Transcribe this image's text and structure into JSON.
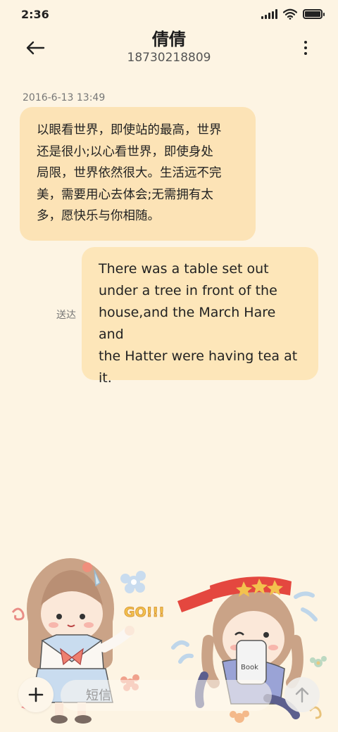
{
  "status_bar": {
    "time": "2:36",
    "battery_level": 1.0
  },
  "header": {
    "contact_name": "倩倩",
    "contact_number": "18730218809"
  },
  "conversation": {
    "timestamp": "2016-6-13 13:49",
    "incoming_lines": [
      "以眼看世界，即使站的最高，世界",
      "还是很小;以心看世界，即使身处",
      "局限，世界依然很大。生活远不完",
      "美，需要用心去体会;无需拥有太",
      "多，愿快乐与你相随。"
    ],
    "outgoing_lines": [
      "There was a table set out",
      "under a tree in front of the",
      "house,and the March Hare and",
      "the Hatter were having tea at",
      "it."
    ],
    "delivery_status": "送达"
  },
  "decor": {
    "go_text": "GO!!!",
    "book_text": "Book"
  },
  "composer": {
    "placeholder": "短信"
  }
}
